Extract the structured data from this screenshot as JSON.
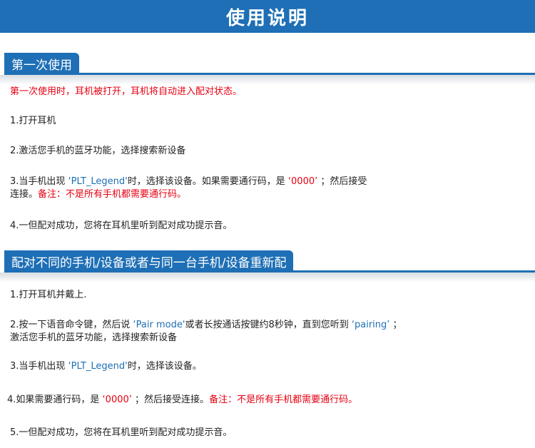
{
  "title": "使用说明",
  "section1": {
    "heading": "第一次使用",
    "intro": "第一次使用时，耳机被打开，耳机将自动进入配对状态。",
    "step1": "1.打开耳机",
    "step2": "2.激活您手机的蓝牙功能，选择搜索新设备",
    "step3_a": "3.当手机出现",
    "step3_name": "‘PLT_Legend'",
    "step3_b": "时，选择该设备。如果需要通行码，是",
    "step3_code": "‘0000’",
    "step3_c": "；然后接受",
    "step3_d": "连接。",
    "step3_note": "备注：不是所有手机都需要通行码。",
    "step4": "4.一但配对成功，您将在耳机里听到配对成功提示音。"
  },
  "section2": {
    "heading": "配对不同的手机/设备或者与同一台手机/设备重新配",
    "step1": "1.打开耳机并戴上.",
    "step2_a": "2.按一下语音命令键，然后说",
    "step2_mode": "‘Pair mode'",
    "step2_b": "或者长按通话按键约8秒钟，直到您听到",
    "step2_pairing": "‘pairing’",
    "step2_c": "；",
    "step2_d": "激活您手机的蓝牙功能，选择搜索新设备",
    "step3_a": "3.当手机出现",
    "step3_name": "‘PLT_Legend'",
    "step3_b": "时，选择该设备。",
    "step4_a": "4.如果需要通行码，是",
    "step4_code": "‘0000’",
    "step4_b": "；然后接受连接。",
    "step4_note": "备注：不是所有手机都需要通行码。",
    "step5": "5.一但配对成功，您将在耳机里听到配对成功提示音。"
  },
  "colors": {
    "accent": "#1e6fb5",
    "note": "#e60012"
  }
}
